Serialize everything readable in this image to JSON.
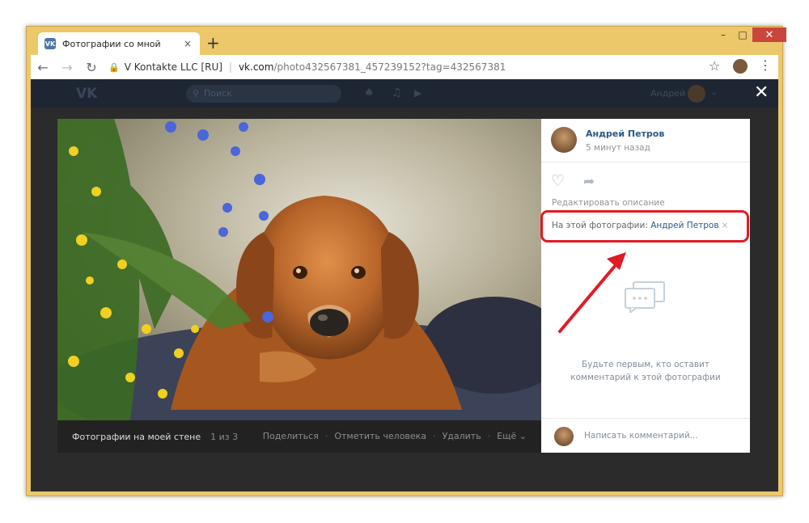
{
  "browser": {
    "tab_title": "Фотографии со мной",
    "tab_close": "×",
    "new_tab": "+",
    "address": {
      "org": "V Kontakte LLC [RU]",
      "host": "vk.com",
      "path": "/photo432567381_457239152?tag=432567381"
    },
    "window_controls": [
      "–",
      "□",
      "✕"
    ]
  },
  "vk_header": {
    "logo": "VK",
    "search_placeholder": "Поиск",
    "user_name": "Андрей"
  },
  "photo_bar": {
    "album": "Фотографии на моей стене",
    "counter": "1 из 3",
    "actions": [
      "Поделиться",
      "Отметить человека",
      "Удалить",
      "Ещё ⌄"
    ]
  },
  "sidebar": {
    "author": "Андрей Петров",
    "time": "5 минут назад",
    "edit_description": "Редактировать описание",
    "tag_label": "На этой фотографии:",
    "tag_person": "Андрей Петров",
    "tag_remove": "×",
    "empty_line1": "Будьте первым, кто оставит",
    "empty_line2": "комментарий к этой фотографии",
    "comment_placeholder": "Написать комментарий..."
  },
  "colors": {
    "frame": "#ecc86a",
    "vk_blue": "#2a5885",
    "highlight": "#e01b24"
  }
}
